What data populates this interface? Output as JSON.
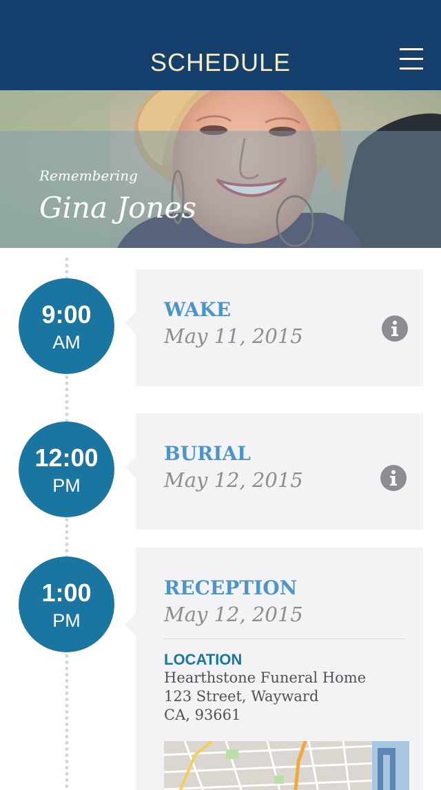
{
  "header": {
    "title": "SCHEDULE",
    "menu_icon": "hamburger-menu-icon",
    "background": "#153f6d",
    "title_color": "#f4edc4"
  },
  "hero": {
    "subtitle": "Remembering",
    "name": "Gina Jones"
  },
  "events": [
    {
      "time": "9:00",
      "meridiem": "AM",
      "title": "WAKE",
      "date": "May 11, 2015",
      "icon": "info-icon"
    },
    {
      "time": "12:00",
      "meridiem": "PM",
      "title": "BURIAL",
      "date": "May 12, 2015",
      "icon": "info-icon"
    },
    {
      "time": "1:00",
      "meridiem": "PM",
      "title": "RECEPTION",
      "date": "May 12, 2015",
      "location_label": "LOCATION",
      "address": [
        "Hearthstone Funeral Home",
        "123 Street, Wayward",
        "CA, 93661"
      ]
    }
  ],
  "colors": {
    "accent": "#1a76a0",
    "title_blue": "#4d95c7",
    "card_bg": "#f3f3f5",
    "muted_text": "#8c8d90"
  }
}
